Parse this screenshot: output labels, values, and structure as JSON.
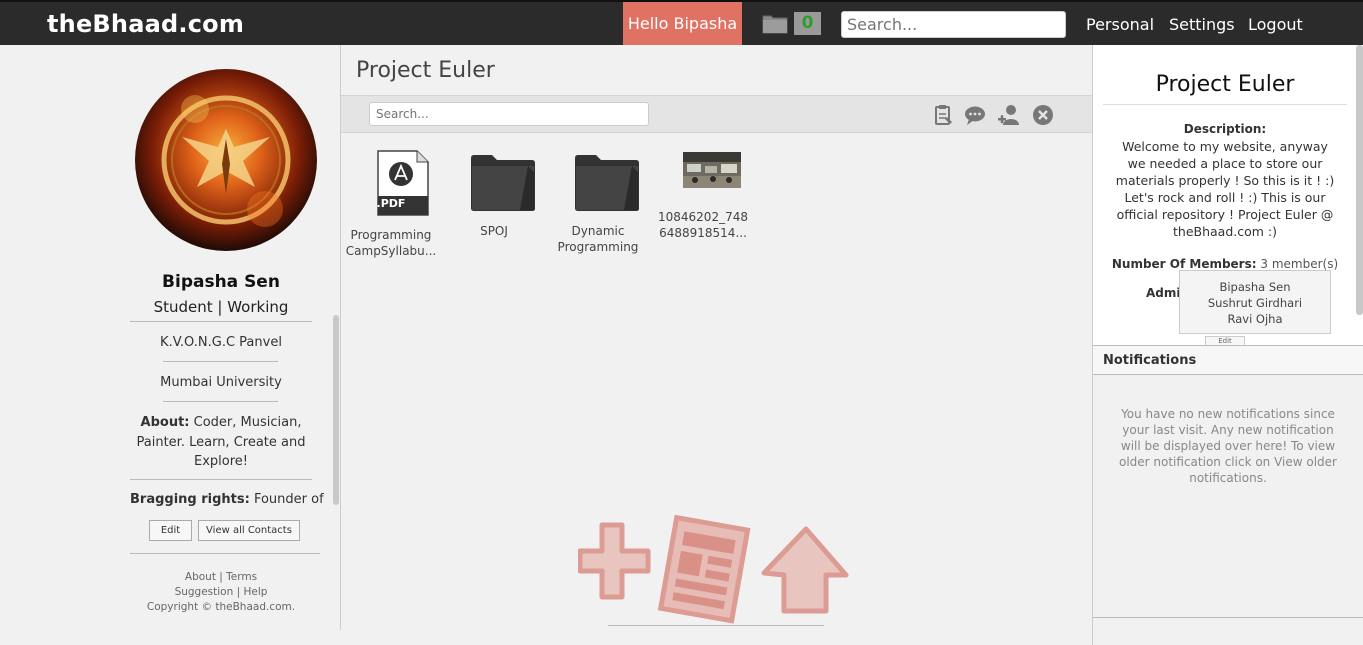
{
  "header": {
    "logo": "theBhaad.com",
    "greeting": "Hello Bipasha",
    "folder_count": "0",
    "search_placeholder": "Search...",
    "nav": [
      "Personal",
      "Settings",
      "Logout"
    ]
  },
  "profile": {
    "name": "Bipasha Sen",
    "role": "Student | Working",
    "school": "K.V.O.N.G.C Panvel",
    "university": "Mumbai University",
    "about_label": "About:",
    "about_text": "Coder, Musician, Painter. Learn, Create and Explore!",
    "brag_label": "Bragging rights:",
    "brag_text": "Founder of",
    "edit_label": "Edit",
    "contacts_label": "View all Contacts",
    "footer_line1": "About | Terms",
    "footer_line2": "Suggestion | Help",
    "footer_line3": "Copyright © theBhaad.com."
  },
  "main": {
    "title": "Project Euler",
    "search_placeholder": "Search...",
    "files": [
      {
        "type": "pdf",
        "label": "Programming CampSyllabu..."
      },
      {
        "type": "folder",
        "label": "SPOJ"
      },
      {
        "type": "folder",
        "label": "Dynamic Programming"
      },
      {
        "type": "image",
        "label": "10846202_748 6488918514..."
      }
    ],
    "pdf_badge": ".PDF"
  },
  "details": {
    "title": "Project Euler",
    "description_label": "Description:",
    "description": "Welcome to my website, anyway we needed a place to store our materials properly ! So this is it ! :) Let's rock and roll ! :) This is our official repository ! Project Euler @ theBhaad.com :)",
    "members_label": "Number Of Members:",
    "members_value": "3 member(s)",
    "admin_label": "Admin",
    "member_list": [
      "Bipasha Sen",
      "Sushrut Girdhari",
      "Ravi Ojha"
    ],
    "peek_button": "Edit"
  },
  "notifications": {
    "heading": "Notifications",
    "text": "You have no new notifications since your last visit. Any new notification will be displayed over here! To view older notification click on View older notifications."
  },
  "colors": {
    "accent": "#e07264",
    "topbar": "#2b2b2b",
    "badge_text": "#2e9c2e"
  }
}
